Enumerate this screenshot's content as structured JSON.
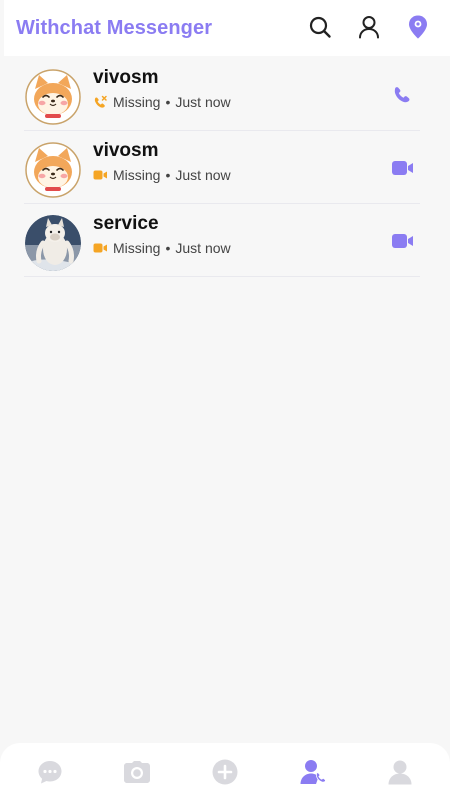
{
  "app": {
    "title": "Withchat Messenger"
  },
  "colors": {
    "accent": "#8b7cf2",
    "missed": "#f5a524",
    "nav_inactive": "#d9d9de"
  },
  "header": {
    "icons": [
      "search-icon",
      "person-icon",
      "location-pin-icon"
    ]
  },
  "calls": [
    {
      "name": "vivosm",
      "type": "voice",
      "status": "Missing",
      "separator": "•",
      "time": "Just now",
      "avatar": "shiba-cartoon",
      "action": "phone-icon"
    },
    {
      "name": "vivosm",
      "type": "video",
      "status": "Missing",
      "separator": "•",
      "time": "Just now",
      "avatar": "shiba-cartoon",
      "action": "video-camera-icon"
    },
    {
      "name": "service",
      "type": "video",
      "status": "Missing",
      "separator": "•",
      "time": "Just now",
      "avatar": "dog-photo",
      "action": "video-camera-icon"
    }
  ],
  "bottom_nav": {
    "items": [
      "chat-icon",
      "camera-icon",
      "add-icon",
      "calls-icon",
      "profile-icon"
    ],
    "active": "calls-icon"
  }
}
